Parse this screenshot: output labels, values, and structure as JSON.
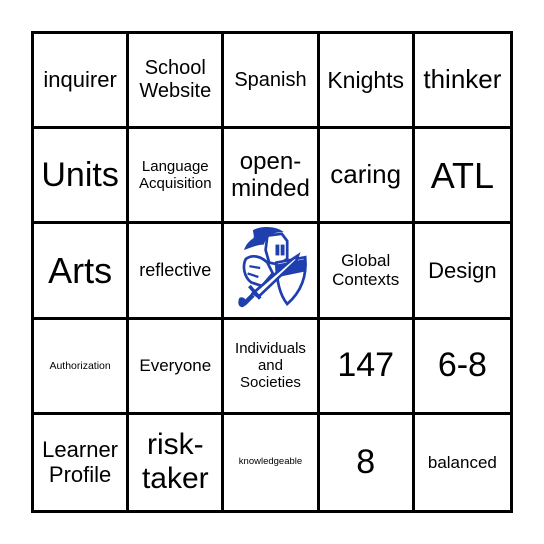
{
  "board": {
    "cells": [
      [
        "inquirer",
        "School Website",
        "Spanish",
        "Knights",
        "thinker"
      ],
      [
        "Units",
        "Language Acquisition",
        "open-minded",
        "caring",
        "ATL"
      ],
      [
        "Arts",
        "reflective",
        "",
        "Global Contexts",
        "Design"
      ],
      [
        "Authorization",
        "Everyone",
        "Individuals and Societies",
        "147",
        "6-8"
      ],
      [
        "Learner Profile",
        "risk-taker",
        "knowledgeable",
        "8",
        "balanced"
      ]
    ],
    "center_image": "knight-mascot-icon",
    "accent_color": "#1f3fae"
  }
}
